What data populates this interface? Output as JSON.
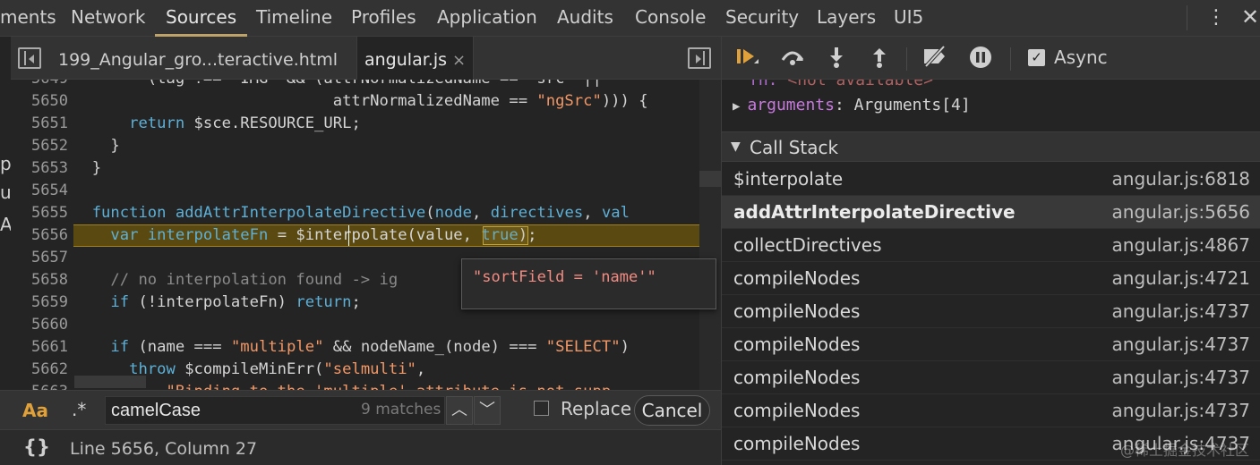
{
  "top_tabs": [
    {
      "label": "ments"
    },
    {
      "label": "Network"
    },
    {
      "label": "Sources"
    },
    {
      "label": "Timeline"
    },
    {
      "label": "Profiles"
    },
    {
      "label": "Application"
    },
    {
      "label": "Audits"
    },
    {
      "label": "Console"
    },
    {
      "label": "Security"
    },
    {
      "label": "Layers"
    },
    {
      "label": "UI5"
    }
  ],
  "active_top_tab": "Sources",
  "top_icons": {
    "more": "⋮",
    "close": "✕"
  },
  "left_strip": {
    "chars": [
      "p",
      "ul",
      "A"
    ]
  },
  "file_tabs": [
    {
      "label": "199_Angular_gro...teractive.html"
    },
    {
      "label": "angular.js",
      "close": "×"
    }
  ],
  "code": {
    "lines": [
      {
        "num": "5649",
        "parts": [
          [
            "plain",
            "        (tag !== 'IMG' && (attrNormalizedName == 'src' ||"
          ]
        ]
      },
      {
        "num": "5650",
        "parts": [
          [
            "plain",
            "                            attrNormalizedName == "
          ],
          [
            "str",
            "\"ngSrc\""
          ],
          [
            "plain",
            ")))"
          ],
          [
            "plain",
            " {"
          ]
        ]
      },
      {
        "num": "5651",
        "parts": [
          [
            "plain",
            "      "
          ],
          [
            "kw",
            "return"
          ],
          [
            "plain",
            " $sce.RESOURCE_URL;"
          ]
        ]
      },
      {
        "num": "5652",
        "parts": [
          [
            "plain",
            "    }"
          ]
        ]
      },
      {
        "num": "5653",
        "parts": [
          [
            "plain",
            "  }"
          ]
        ]
      },
      {
        "num": "5654",
        "parts": [
          [
            "plain",
            ""
          ]
        ]
      },
      {
        "num": "5655",
        "parts": [
          [
            "plain",
            "  "
          ],
          [
            "kw",
            "function"
          ],
          [
            "plain",
            " "
          ],
          [
            "fn",
            "addAttrInterpolateDirective"
          ],
          [
            "plain",
            "("
          ],
          [
            "fn",
            "node"
          ],
          [
            "plain",
            ", "
          ],
          [
            "fn",
            "directives"
          ],
          [
            "plain",
            ", "
          ],
          [
            "fn",
            "val"
          ]
        ]
      },
      {
        "num": "5656",
        "parts": [
          [
            "plain",
            "    "
          ],
          [
            "kw",
            "var"
          ],
          [
            "plain",
            " "
          ],
          [
            "fn",
            "interpolateFn"
          ],
          [
            "plain",
            " = $interpolate(value, "
          ],
          [
            "kw",
            "true"
          ],
          [
            "plain",
            ");"
          ]
        ]
      },
      {
        "num": "5657",
        "parts": [
          [
            "plain",
            ""
          ]
        ]
      },
      {
        "num": "5658",
        "parts": [
          [
            "plain",
            "    "
          ],
          [
            "cm",
            "// no interpolation found -> ig"
          ]
        ]
      },
      {
        "num": "5659",
        "parts": [
          [
            "plain",
            "    "
          ],
          [
            "kw",
            "if"
          ],
          [
            "plain",
            " (!interpolateFn) "
          ],
          [
            "kw",
            "return"
          ],
          [
            "plain",
            ";"
          ]
        ]
      },
      {
        "num": "5660",
        "parts": [
          [
            "plain",
            ""
          ]
        ]
      },
      {
        "num": "5661",
        "parts": [
          [
            "plain",
            "    "
          ],
          [
            "kw",
            "if"
          ],
          [
            "plain",
            " (name === "
          ],
          [
            "str",
            "\"multiple\""
          ],
          [
            "plain",
            " && nodeName_(node) === "
          ],
          [
            "str",
            "\"SELECT\""
          ],
          [
            "plain",
            ")"
          ]
        ]
      },
      {
        "num": "5662",
        "parts": [
          [
            "plain",
            "      "
          ],
          [
            "kw",
            "throw"
          ],
          [
            "plain",
            " $compileMinErr("
          ],
          [
            "str",
            "\"selmulti\""
          ],
          [
            "plain",
            ","
          ]
        ]
      },
      {
        "num": "5663",
        "parts": [
          [
            "plain",
            "          "
          ],
          [
            "str",
            "\"Binding to the 'multiple' attribute is not supp"
          ]
        ]
      }
    ],
    "tooltip": "\"sortField = 'name'\""
  },
  "search": {
    "case_label": "Aa",
    "regex_label": ".*",
    "value": "camelCase",
    "matches": "9 matches",
    "up": "︿",
    "down": "﹀",
    "replace_label": "Replace",
    "cancel_label": "Cancel"
  },
  "status": {
    "braces": "{}",
    "position": "Line 5656, Column 27"
  },
  "debugger": {
    "async_label": "Async",
    "scope_line1_key": "fn:",
    "scope_line1_value": "<not available>",
    "scope_line2_key": "arguments",
    "scope_line2_value": ": Arguments[4]",
    "callstack_title": "Call Stack",
    "frames": [
      {
        "name": "$interpolate",
        "loc": "angular.js:6818"
      },
      {
        "name": "addAttrInterpolateDirective",
        "loc": "angular.js:5656"
      },
      {
        "name": "collectDirectives",
        "loc": "angular.js:4867"
      },
      {
        "name": "compileNodes",
        "loc": "angular.js:4721"
      },
      {
        "name": "compileNodes",
        "loc": "angular.js:4737"
      },
      {
        "name": "compileNodes",
        "loc": "angular.js:4737"
      },
      {
        "name": "compileNodes",
        "loc": "angular.js:4737"
      },
      {
        "name": "compileNodes",
        "loc": "angular.js:4737"
      },
      {
        "name": "compileNodes",
        "loc": "angular.js:4737"
      }
    ],
    "selected_frame": 1
  },
  "watermark": "@稀土掘金技术社区",
  "colors": {
    "accent": "#e0a13a",
    "exec_line": "#5a4a12",
    "keyword": "#5db0d7",
    "string": "#f29766"
  }
}
